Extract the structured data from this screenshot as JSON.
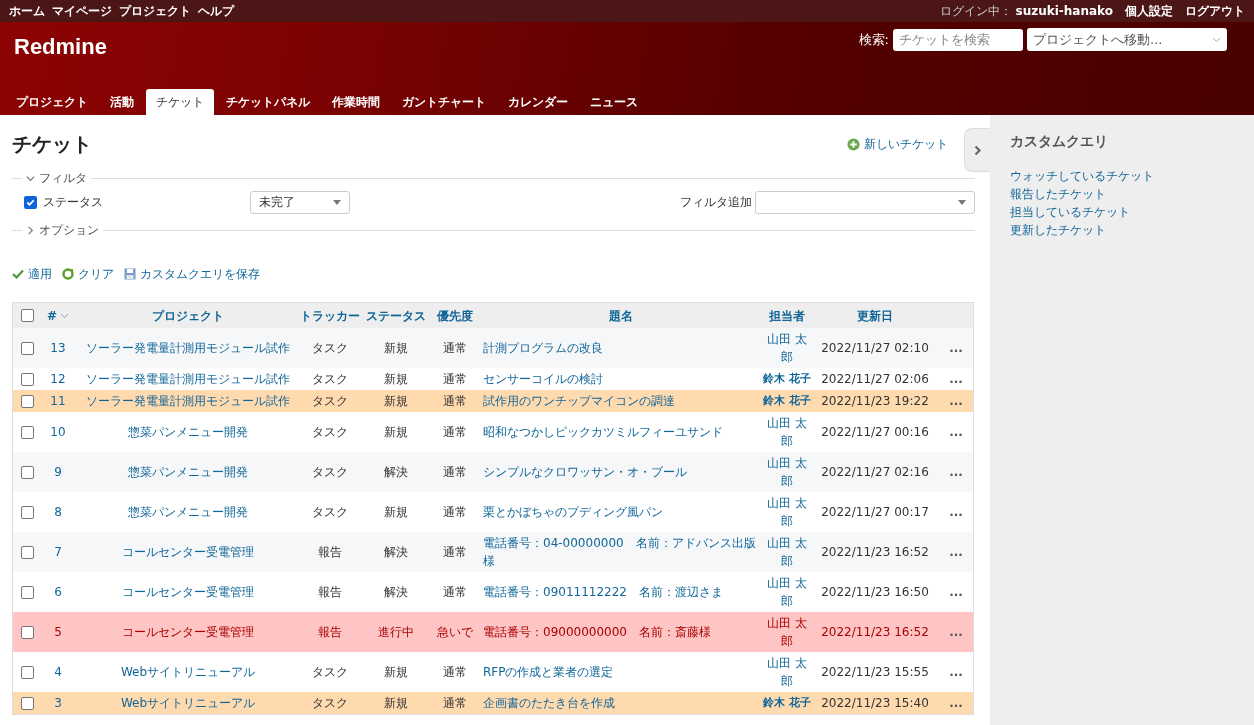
{
  "top_menu": [
    "ホーム",
    "マイページ",
    "プロジェクト",
    "ヘルプ"
  ],
  "account": {
    "logged_in_label": "ログイン中：",
    "user": "suzuki-hanako",
    "links": [
      "個人設定",
      "ログアウト"
    ]
  },
  "header": {
    "title": "Redmine",
    "search_label": "検索:",
    "search": {
      "placeholder": "チケットを検索"
    },
    "project_jump": "プロジェクトへ移動..."
  },
  "tabs": [
    {
      "label": "プロジェクト",
      "selected": false
    },
    {
      "label": "活動",
      "selected": false
    },
    {
      "label": "チケット",
      "selected": true
    },
    {
      "label": "チケットパネル",
      "selected": false
    },
    {
      "label": "作業時間",
      "selected": false
    },
    {
      "label": "ガントチャート",
      "selected": false
    },
    {
      "label": "カレンダー",
      "selected": false
    },
    {
      "label": "ニュース",
      "selected": false
    }
  ],
  "page_title": "チケット",
  "new_issue": "新しいチケット",
  "filters": {
    "legend": "フィルタ",
    "expanded": true,
    "status_filter": {
      "label": "ステータス",
      "checked": true,
      "value": "未完了"
    },
    "add_label": "フィルタ追加"
  },
  "options": {
    "legend": "オプション",
    "expanded": false
  },
  "actions": [
    "適用",
    "クリア",
    "カスタムクエリを保存"
  ],
  "table": {
    "select_all_checked": false,
    "columns": [
      "#",
      "プロジェクト",
      "トラッカー",
      "ステータス",
      "優先度",
      "題名",
      "担当者",
      "更新日"
    ],
    "rows": [
      {
        "checked": false,
        "assigned_to_me": false,
        "flagged": false,
        "urgent": false,
        "id": "13",
        "project": "ソーラー発電量計測用モジュール試作",
        "tracker": "タスク",
        "status": "新規",
        "priority": "通常",
        "subject": "計測プログラムの改良",
        "assignee": "山田 太郎",
        "updated": "2022/11/27 02:10",
        "menu": "..."
      },
      {
        "checked": false,
        "assigned_to_me": true,
        "flagged": false,
        "urgent": false,
        "id": "12",
        "project": "ソーラー発電量計測用モジュール試作",
        "tracker": "タスク",
        "status": "新規",
        "priority": "通常",
        "subject": "センサーコイルの検討",
        "assignee": "鈴木 花子",
        "updated": "2022/11/27 02:06",
        "menu": "..."
      },
      {
        "checked": false,
        "assigned_to_me": true,
        "flagged": true,
        "urgent": false,
        "id": "11",
        "project": "ソーラー発電量計測用モジュール試作",
        "tracker": "タスク",
        "status": "新規",
        "priority": "通常",
        "subject": "試作用のワンチップマイコンの調達",
        "assignee": "鈴木 花子",
        "updated": "2022/11/23 19:22",
        "menu": "..."
      },
      {
        "checked": false,
        "assigned_to_me": false,
        "flagged": false,
        "urgent": false,
        "id": "10",
        "project": "惣菜パンメニュー開発",
        "tracker": "タスク",
        "status": "新規",
        "priority": "通常",
        "subject": "昭和なつかしピックカツミルフィーユサンド",
        "assignee": "山田 太郎",
        "updated": "2022/11/27 00:16",
        "menu": "..."
      },
      {
        "checked": false,
        "assigned_to_me": false,
        "flagged": false,
        "urgent": false,
        "id": "9",
        "project": "惣菜パンメニュー開発",
        "tracker": "タスク",
        "status": "解決",
        "priority": "通常",
        "subject": "シンプルなクロワッサン・オ・ブール",
        "assignee": "山田 太郎",
        "updated": "2022/11/27 02:16",
        "menu": "..."
      },
      {
        "checked": false,
        "assigned_to_me": false,
        "flagged": false,
        "urgent": false,
        "id": "8",
        "project": "惣菜パンメニュー開発",
        "tracker": "タスク",
        "status": "新規",
        "priority": "通常",
        "subject": "栗とかぼちゃのプディング風パン",
        "assignee": "山田 太郎",
        "updated": "2022/11/27 00:17",
        "menu": "..."
      },
      {
        "checked": false,
        "assigned_to_me": false,
        "flagged": false,
        "urgent": false,
        "id": "7",
        "project": "コールセンター受電管理",
        "tracker": "報告",
        "status": "解決",
        "priority": "通常",
        "subject": "電話番号：04-00000000　名前：アドバンス出版様",
        "assignee": "山田 太郎",
        "updated": "2022/11/23 16:52",
        "menu": "..."
      },
      {
        "checked": false,
        "assigned_to_me": false,
        "flagged": false,
        "urgent": false,
        "id": "6",
        "project": "コールセンター受電管理",
        "tracker": "報告",
        "status": "解決",
        "priority": "通常",
        "subject": "電話番号：09011112222　名前：渡辺さま",
        "assignee": "山田 太郎",
        "updated": "2022/11/23 16:50",
        "menu": "..."
      },
      {
        "checked": false,
        "assigned_to_me": false,
        "flagged": false,
        "urgent": true,
        "id": "5",
        "project": "コールセンター受電管理",
        "tracker": "報告",
        "status": "進行中",
        "priority": "急いで",
        "subject": "電話番号：09000000000　名前：斎藤様",
        "assignee": "山田 太郎",
        "updated": "2022/11/23 16:52",
        "menu": "..."
      },
      {
        "checked": false,
        "assigned_to_me": false,
        "flagged": false,
        "urgent": false,
        "id": "4",
        "project": "Webサイトリニューアル",
        "tracker": "タスク",
        "status": "新規",
        "priority": "通常",
        "subject": "RFPの作成と業者の選定",
        "assignee": "山田 太郎",
        "updated": "2022/11/23 15:55",
        "menu": "..."
      },
      {
        "checked": false,
        "assigned_to_me": true,
        "flagged": true,
        "urgent": false,
        "id": "3",
        "project": "Webサイトリニューアル",
        "tracker": "タスク",
        "status": "新規",
        "priority": "通常",
        "subject": "企画書のたたき台を作成",
        "assignee": "鈴木 花子",
        "updated": "2022/11/23 15:40",
        "menu": "..."
      }
    ]
  },
  "sidebar": {
    "title": "カスタムクエリ",
    "items": [
      "ウォッチしているチケット",
      "報告したチケット",
      "担当しているチケット",
      "更新したチケット"
    ]
  }
}
